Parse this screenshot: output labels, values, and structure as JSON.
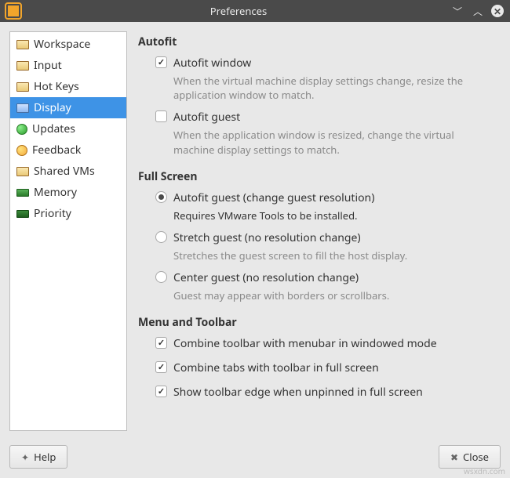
{
  "window": {
    "title": "Preferences"
  },
  "sidebar": {
    "items": [
      {
        "label": "Workspace",
        "icon": "folder"
      },
      {
        "label": "Input",
        "icon": "folder"
      },
      {
        "label": "Hot Keys",
        "icon": "folder"
      },
      {
        "label": "Display",
        "icon": "display",
        "selected": true
      },
      {
        "label": "Updates",
        "icon": "updates"
      },
      {
        "label": "Feedback",
        "icon": "feedback"
      },
      {
        "label": "Shared VMs",
        "icon": "folder"
      },
      {
        "label": "Memory",
        "icon": "memory"
      },
      {
        "label": "Priority",
        "icon": "priority"
      }
    ]
  },
  "main": {
    "autofit": {
      "heading": "Autofit",
      "window": {
        "label": "Autofit window",
        "checked": true,
        "desc": "When the virtual machine display settings change, resize the application window to match."
      },
      "guest": {
        "label": "Autofit guest",
        "checked": false,
        "desc": "When the application window is resized, change the virtual machine display settings to match."
      }
    },
    "fullscreen": {
      "heading": "Full Screen",
      "autofit": {
        "label": "Autofit guest (change guest resolution)",
        "selected": true,
        "desc": "Requires VMware Tools to be installed."
      },
      "stretch": {
        "label": "Stretch guest (no resolution change)",
        "selected": false,
        "desc": "Stretches the guest screen to fill the host display."
      },
      "center": {
        "label": "Center guest (no resolution change)",
        "selected": false,
        "desc": "Guest may appear with borders or scrollbars."
      }
    },
    "menutoolbar": {
      "heading": "Menu and Toolbar",
      "combine_menubar": {
        "label": "Combine toolbar with menubar in windowed mode",
        "checked": true
      },
      "combine_tabs": {
        "label": "Combine tabs with toolbar in full screen",
        "checked": true
      },
      "show_edge": {
        "label": "Show toolbar edge when unpinned in full screen",
        "checked": true
      }
    }
  },
  "footer": {
    "help": "Help",
    "close": "Close"
  },
  "watermark": "wsxdn.com"
}
